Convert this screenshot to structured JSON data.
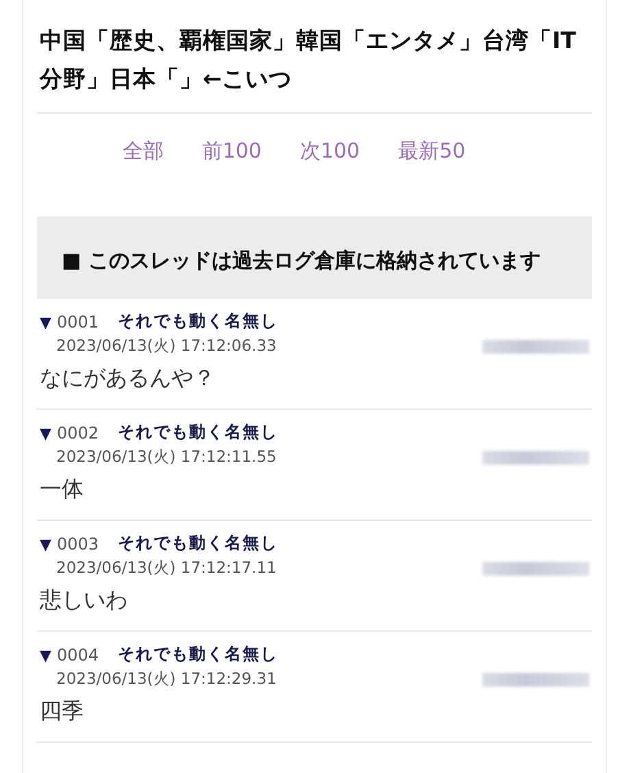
{
  "thread": {
    "title": "中国「歴史、覇権国家」韓国「エンタメ」台湾「IT分野」日本「」←こいつ"
  },
  "nav": [
    "全部",
    "前100",
    "次100",
    "最新50"
  ],
  "notice": {
    "mark": "■",
    "text": "このスレッドは過去ログ倉庫に格納されています"
  },
  "posts": [
    {
      "marker": "▼",
      "number": "0001",
      "name": "それでも動く名無し",
      "date": "2023/06/13(火) 17:12:06.33",
      "body": "なにがあるんや？"
    },
    {
      "marker": "▼",
      "number": "0002",
      "name": "それでも動く名無し",
      "date": "2023/06/13(火) 17:12:11.55",
      "body": "一体"
    },
    {
      "marker": "▼",
      "number": "0003",
      "name": "それでも動く名無し",
      "date": "2023/06/13(火) 17:12:17.11",
      "body": "悲しいわ"
    },
    {
      "marker": "▼",
      "number": "0004",
      "name": "それでも動く名無し",
      "date": "2023/06/13(火) 17:12:29.31",
      "body": "四季"
    }
  ]
}
